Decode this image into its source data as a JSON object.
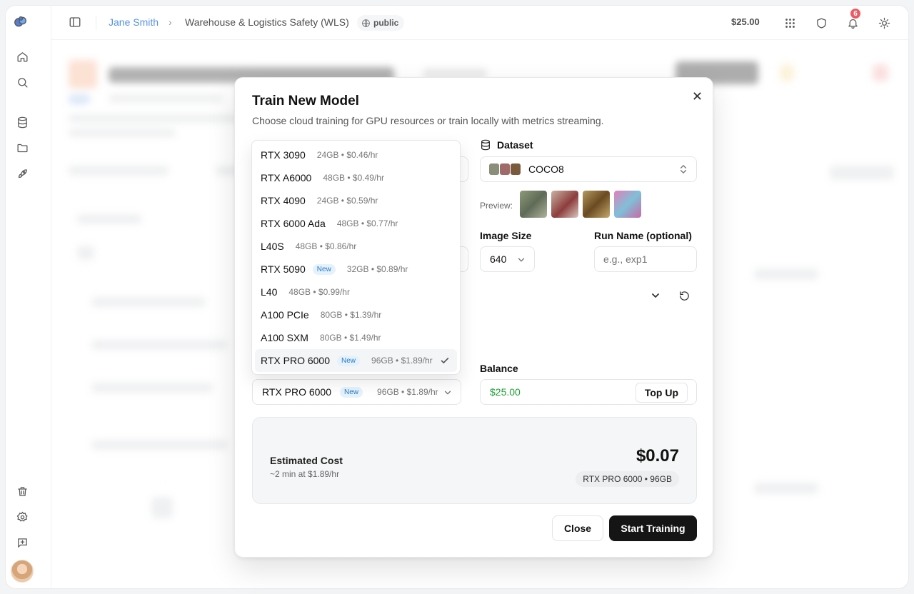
{
  "header": {
    "user": "Jane Smith",
    "project": "Warehouse & Logistics Safety (WLS)",
    "visibility": "public",
    "balance": "$25.00",
    "notifications": "6"
  },
  "modal": {
    "title": "Train New Model",
    "subtitle": "Choose cloud training for GPU resources or train locally with metrics streaming.",
    "dataset_label": "Dataset",
    "dataset_value": "COCO8",
    "preview_label": "Preview:",
    "image_size_label": "Image Size",
    "image_size_value": "640",
    "run_name_label": "Run Name (optional)",
    "run_name_placeholder": "e.g., exp1",
    "balance_label": "Balance",
    "balance_value": "$25.00",
    "top_up": "Top Up",
    "selected_gpu": {
      "name": "RTX PRO 6000",
      "badge": "New",
      "spec": "96GB • $1.89/hr"
    },
    "estimated_cost_label": "Estimated Cost",
    "estimated_cost_sub": "~2 min at $1.89/hr",
    "estimated_cost_value": "$0.07",
    "estimated_cost_gpu": "RTX PRO 6000 • 96GB",
    "close_button": "Close",
    "start_button": "Start Training"
  },
  "gpu_options": [
    {
      "name": "RTX 3090",
      "badge": "",
      "spec": "24GB • $0.46/hr"
    },
    {
      "name": "RTX A6000",
      "badge": "",
      "spec": "48GB • $0.49/hr"
    },
    {
      "name": "RTX 4090",
      "badge": "",
      "spec": "24GB • $0.59/hr"
    },
    {
      "name": "RTX 6000 Ada",
      "badge": "",
      "spec": "48GB • $0.77/hr"
    },
    {
      "name": "L40S",
      "badge": "",
      "spec": "48GB • $0.86/hr"
    },
    {
      "name": "RTX 5090",
      "badge": "New",
      "spec": "32GB • $0.89/hr"
    },
    {
      "name": "L40",
      "badge": "",
      "spec": "48GB • $0.99/hr"
    },
    {
      "name": "A100 PCIe",
      "badge": "",
      "spec": "80GB • $1.39/hr"
    },
    {
      "name": "A100 SXM",
      "badge": "",
      "spec": "80GB • $1.49/hr"
    },
    {
      "name": "RTX PRO 6000",
      "badge": "New",
      "spec": "96GB • $1.89/hr"
    }
  ],
  "colors": {
    "accent_link": "#1f6fd1",
    "balance_green": "#1e9e37",
    "primary_button": "#151515",
    "notification_red": "#e5252f"
  }
}
